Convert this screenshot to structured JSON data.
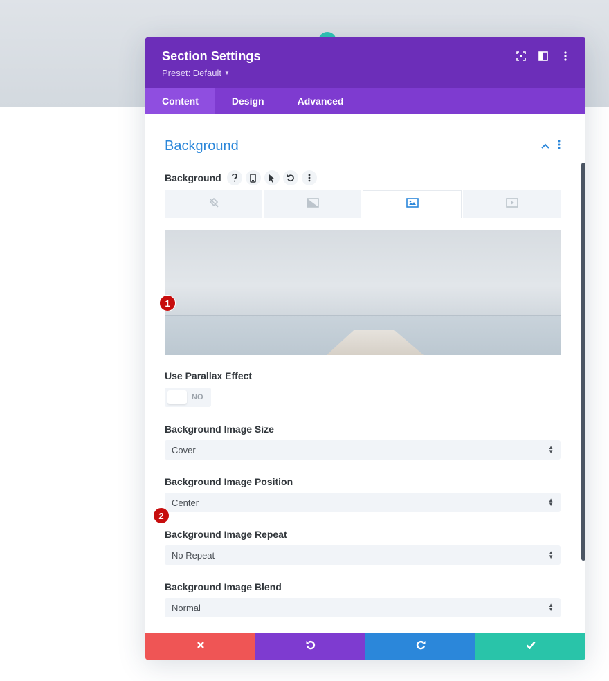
{
  "modal": {
    "title": "Section Settings",
    "preset": "Preset: Default",
    "header_icons": [
      "expand-icon",
      "sidebar-layout-icon",
      "more-vertical-icon"
    ]
  },
  "tabs": [
    {
      "label": "Content",
      "active": true
    },
    {
      "label": "Design",
      "active": false
    },
    {
      "label": "Advanced",
      "active": false
    }
  ],
  "section": {
    "title": "Background"
  },
  "background": {
    "label": "Background",
    "option_icons": [
      "help-icon",
      "mobile-icon",
      "hover-cursor-icon",
      "reset-icon",
      "more-vertical-icon"
    ],
    "type_tabs": [
      "color-icon",
      "gradient-icon",
      "image-icon",
      "video-icon"
    ],
    "active_type": "image-icon"
  },
  "badges": {
    "first": "1",
    "second": "2"
  },
  "parallax": {
    "label": "Use Parallax Effect",
    "value": "NO"
  },
  "fields": [
    {
      "label": "Background Image Size",
      "value": "Cover"
    },
    {
      "label": "Background Image Position",
      "value": "Center"
    },
    {
      "label": "Background Image Repeat",
      "value": "No Repeat"
    },
    {
      "label": "Background Image Blend",
      "value": "Normal"
    }
  ],
  "footer": {
    "buttons": [
      "close-icon",
      "undo-icon",
      "redo-icon",
      "check-icon"
    ]
  },
  "colors": {
    "header": "#6c2eb9",
    "tabs": "#7e3bd0",
    "accent_blue": "#2b87da",
    "cancel": "#ef5555",
    "save": "#29c4a9",
    "badge": "#c70d0d"
  }
}
